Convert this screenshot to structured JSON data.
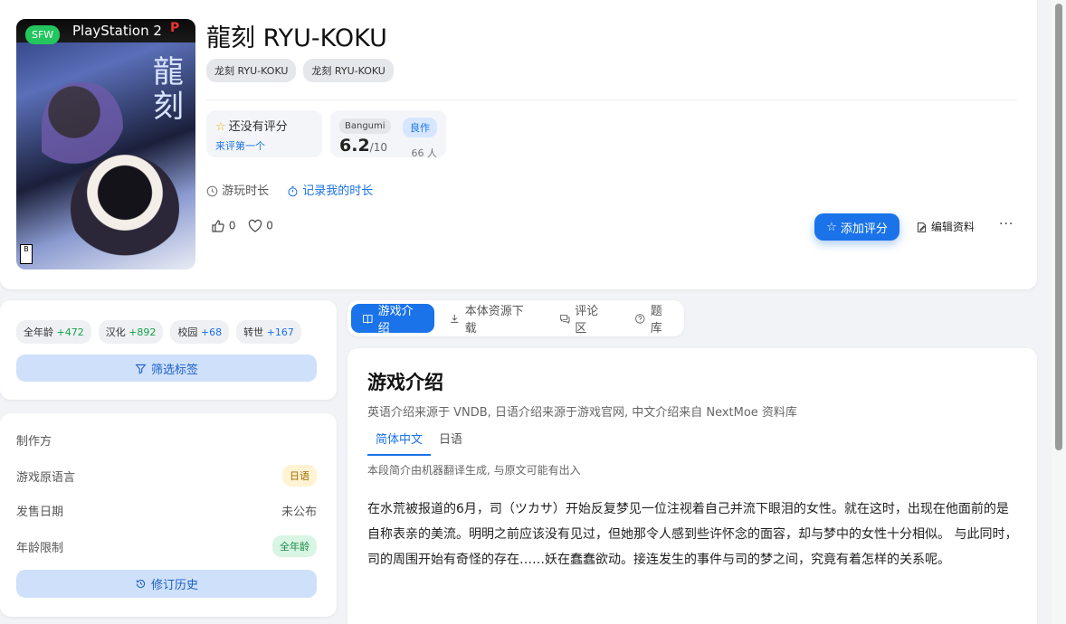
{
  "cover": {
    "badge": "SFW",
    "platform_text": "PlayStation 2",
    "logo_text": "龍刻"
  },
  "game": {
    "title": "龍刻 RYU-KOKU",
    "aliases": [
      "龙刻 RYU-KOKU",
      "龙刻 RYU-KOKU"
    ]
  },
  "my_rating": {
    "label": "还没有评分",
    "link": "来评第一个"
  },
  "bangumi": {
    "source": "Bangumi",
    "tag": "良作",
    "score": "6.2",
    "scale": "/10",
    "count": "66 人"
  },
  "playtime": {
    "label": "游玩时长",
    "record": "记录我的时长"
  },
  "reactions": {
    "likes": "0",
    "favorites": "0"
  },
  "actions": {
    "add_score": "添加评分",
    "edit": "编辑资料",
    "more": "···"
  },
  "tags": [
    {
      "name": "全年龄",
      "count": "+472"
    },
    {
      "name": "汉化",
      "count": "+892"
    },
    {
      "name": "校园",
      "count": "+68"
    },
    {
      "name": "转世",
      "count": "+167"
    }
  ],
  "filter_tags_label": "筛选标签",
  "info": {
    "producer_label": "制作方",
    "lang_label": "游戏原语言",
    "lang_value": "日语",
    "release_label": "发售日期",
    "release_value": "未公布",
    "age_label": "年龄限制",
    "age_value": "全年龄",
    "history_label": "修订历史"
  },
  "tabs": [
    "游戏介绍",
    "本体资源下载",
    "评论区",
    "题库"
  ],
  "intro": {
    "title": "游戏介绍",
    "source": "英语介绍来源于 VNDB, 日语介绍来源于游戏官网, 中文介绍来自 NextMoe 资料库",
    "lang_tabs": [
      "简体中文",
      "日语"
    ],
    "mt_note": "本段简介由机器翻译生成, 与原文可能有出入",
    "text": "在水荒被报道的6月，司（ツカサ）开始反复梦见一位注视着自己并流下眼泪的女性。就在这时，出现在他面前的是自称表亲的美流。明明之前应该没有见过，但她那令人感到些许怀念的面容，却与梦中的女性十分相似。 与此同时，司的周围开始有奇怪的存在……妖在蠢蠢欲动。接连发生的事件与司的梦之间，究竟有着怎样的关系呢。"
  },
  "colors": {
    "accent": "#1a73e8",
    "sfw": "#22c55e",
    "tag_green": "#16a34a",
    "tag_blue": "#1a73e8"
  }
}
